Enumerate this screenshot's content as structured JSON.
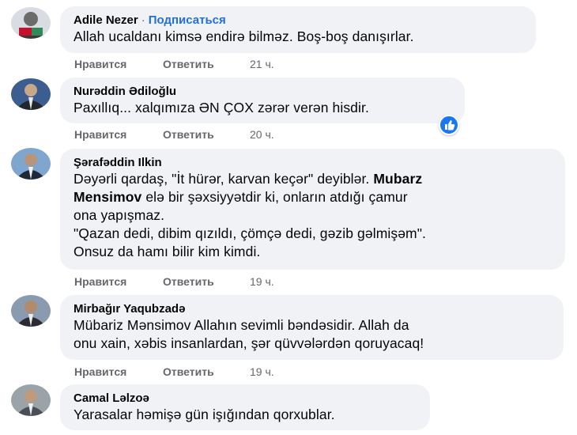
{
  "comments": [
    {
      "author": "Adile Nezer",
      "separator": "·",
      "subscribe": "Подписаться",
      "lines": [
        "Allah ucaldanı kimsə endirə bilməz. Boş-boş danışırlar."
      ],
      "like": "Нравится",
      "reply": "Ответить",
      "time": "21 ч."
    },
    {
      "author": "Nurəddin Ədiloğlu",
      "lines": [
        "Paxıllıq... xalqımıza ƏN ÇOX zərər verən hisdir."
      ],
      "like": "Нравится",
      "reply": "Ответить",
      "time": "20 ч.",
      "reaction": "like-reaction-icon"
    },
    {
      "author": "Şərafəddin Ilkin",
      "line1": "Dəyərli qardaş, \"İt hürər, karvan keçər\" deyiblər.",
      "line1_bold": "Mubarz",
      "line2_bold": "Mensimov",
      "line2": " elə bir şəxsiyyətdir ki, onların atdığı çamur",
      "line3": "ona yapışmaz.",
      "line4": "\"Qazan dedi, dibim qızıldı, çömçə dedi, gəzib gəlmişəm\".",
      "line5": "Onsuz da hamı bilir kim kimdi.",
      "like": "Нравится",
      "reply": "Ответить",
      "time": "19 ч."
    },
    {
      "author": "Mirbağır Yaqubzadə",
      "lines": [
        "Mübariz Mənsimov Allahın sevimli bəndəsidir. Allah da",
        "onu xain, xəbis insanlardan, şər qüvvələrdən qoruyacaq!"
      ],
      "like": "Нравится",
      "reply": "Ответить",
      "time": "19 ч."
    },
    {
      "author": "Camal Ləlzoə",
      "lines": [
        "Yarasalar həmişə gün işığından qorxublar."
      ]
    }
  ],
  "colors": {
    "bubble": "#f0f2f5",
    "link": "#216fdb",
    "meta": "#65676b",
    "reaction": "#1877f2"
  }
}
